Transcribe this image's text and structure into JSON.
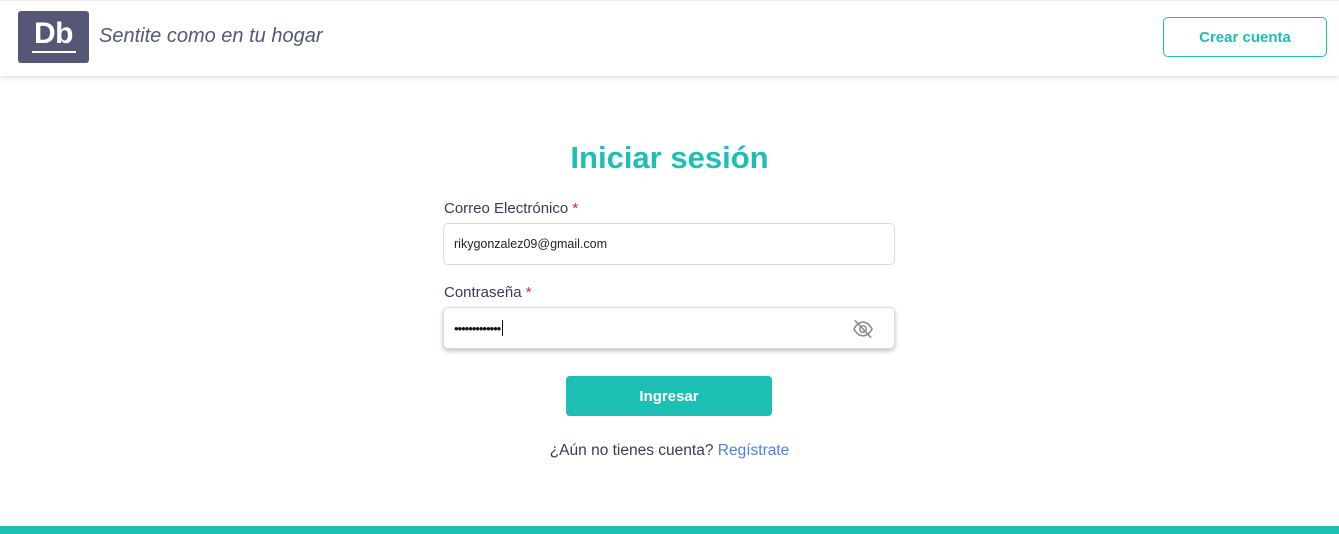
{
  "header": {
    "logo_text": "Db",
    "tagline": "Sentite como en tu hogar",
    "create_account_label": "Crear cuenta"
  },
  "login": {
    "title": "Iniciar sesión",
    "email": {
      "label": "Correo Electrónico",
      "required_mark": "*",
      "value": "rikygonzalez09@gmail.com"
    },
    "password": {
      "label": "Contraseña",
      "required_mark": "*",
      "masked_value": "•••••••••••••",
      "toggle_icon": "eye-slash-icon"
    },
    "submit_label": "Ingresar",
    "signup_prompt": "¿Aún no tienes cuenta?",
    "signup_link": "Regístrate"
  },
  "colors": {
    "primary": "#1dbeb4",
    "secondary": "#545776",
    "text": "#383b58",
    "link": "#4f7fe0",
    "required": "#d72638"
  }
}
